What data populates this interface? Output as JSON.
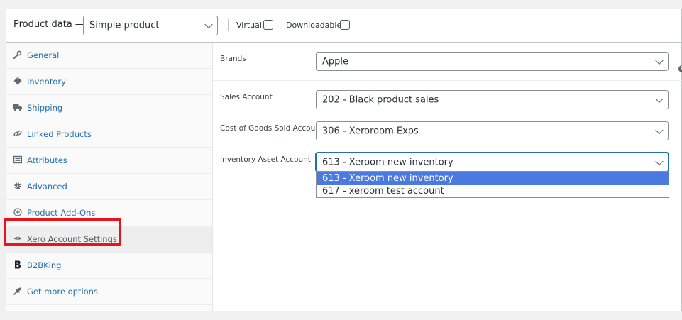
{
  "header": {
    "product_data_label": "Product data —",
    "product_type_value": "Simple product",
    "virtual_label": "Virtual:",
    "downloadable_label": "Downloadable:"
  },
  "sidebar": {
    "items": [
      {
        "label": "General",
        "icon": "wrench-icon"
      },
      {
        "label": "Inventory",
        "icon": "tag-icon"
      },
      {
        "label": "Shipping",
        "icon": "truck-icon"
      },
      {
        "label": "Linked Products",
        "icon": "link-icon"
      },
      {
        "label": "Attributes",
        "icon": "list-icon"
      },
      {
        "label": "Advanced",
        "icon": "gear-icon"
      },
      {
        "label": "Product Add-Ons",
        "icon": "plus-circle-icon"
      },
      {
        "label": "Xero Account Settings",
        "icon": "eye-icon",
        "active": true
      },
      {
        "label": "B2BKing",
        "icon": "b2bking-icon"
      },
      {
        "label": "Get more options",
        "icon": "plugin-icon"
      }
    ]
  },
  "fields": {
    "brands": {
      "label": "Brands",
      "value": "Apple"
    },
    "sales_account": {
      "label": "Sales Account",
      "value": "202 - Black product sales"
    },
    "cogs_account": {
      "label": "Cost of Goods Sold Account",
      "value": "306 - Xeroroom Exps"
    },
    "inventory_asset_account": {
      "label": "Inventory Asset Account",
      "value": "613 - Xeroom new inventory"
    }
  },
  "dropdown": {
    "options": [
      "613 - Xeroom new inventory",
      "617 - xeroom test account"
    ],
    "selected": "613 - Xeroom new inventory"
  },
  "colors": {
    "link": "#2271b1",
    "highlight_border": "#e8141b",
    "selected_option": "#4a7ae0"
  }
}
